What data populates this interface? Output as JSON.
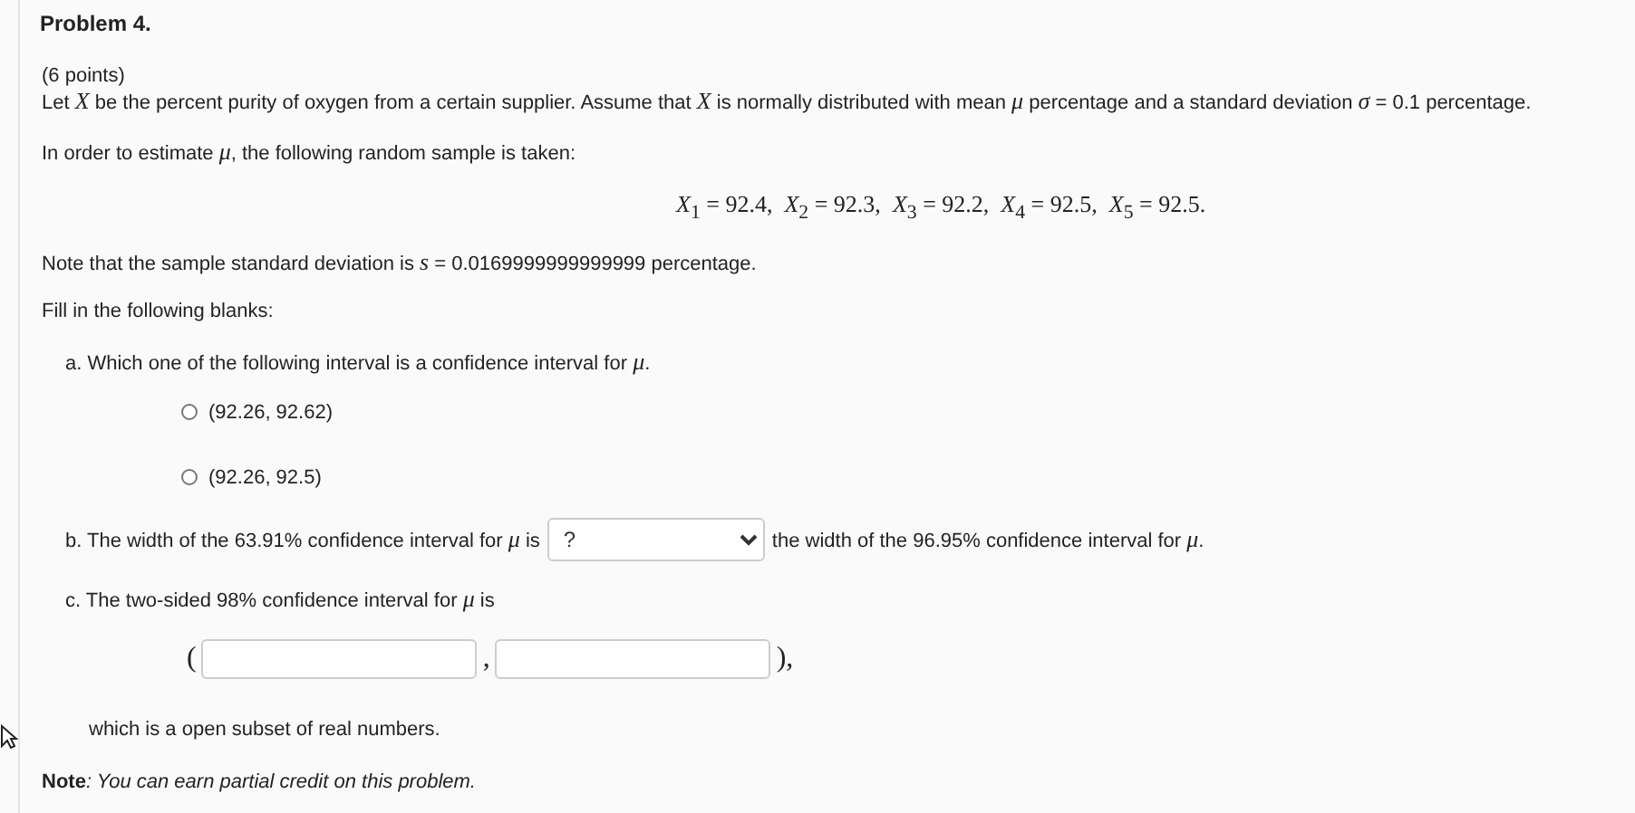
{
  "title": "Problem 4.",
  "points": "(6 points)",
  "statement": "Let *X* be the percent purity of oxygen from a certain supplier. Assume that *X* is normally distributed with mean *μ* percentage and a standard deviation *σ* = 0.1 percentage.",
  "estimate": "In order to estimate *μ*, the following random sample is taken:",
  "sample": "*X*$_{1}$ = 92.4,  *X*$_{2}$ = 92.3,  *X*$_{3}$ = 92.2,  *X*$_{4}$ = 92.5,  *X*$_{5}$ = 92.5.",
  "sd_note": "Note that the sample standard deviation is *s* = 0.0169999999999999 percentage.",
  "fill_in": "Fill in the following blanks:",
  "part_a": {
    "question": "a. Which one of the following interval is a confidence interval for *μ*.",
    "options": [
      {
        "label": "(92.26, 92.62)",
        "selected": false
      },
      {
        "label": "(92.26, 92.5)",
        "selected": false
      }
    ]
  },
  "part_b": {
    "prefix": "b. The width of the 63.91% confidence interval for *μ* is",
    "dropdown": "?",
    "suffix": "the width of the 96.95% confidence interval for *μ*."
  },
  "part_c": {
    "question": "c. The two-sided 98% confidence interval for *μ* is",
    "open": "(",
    "separator": ",",
    "close": "),",
    "fields": [
      {
        "kind": "text"
      },
      {
        "kind": "text"
      }
    ],
    "remark": "which is a open subset of real numbers."
  },
  "note": {
    "label": "Note",
    "text": ": You can earn partial credit on this problem."
  }
}
